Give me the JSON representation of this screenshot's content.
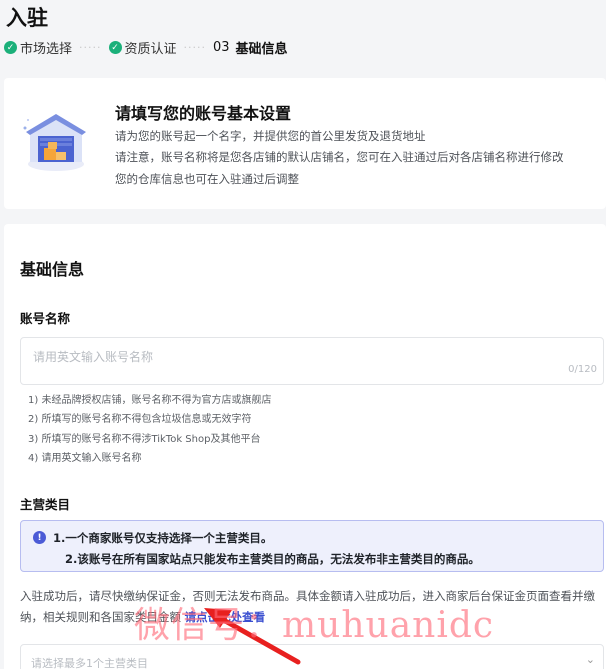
{
  "page": {
    "title": "入驻"
  },
  "steps": [
    {
      "label": "市场选择",
      "status": "done"
    },
    {
      "label": "资质认证",
      "status": "done"
    },
    {
      "num": "03",
      "label": "基础信息",
      "status": "current"
    }
  ],
  "intro": {
    "title": "请填写您的账号基本设置",
    "lines": [
      "请为您的账号起一个名字，并提供您的首公里发货及退货地址",
      "请注意，账号名称将是您各店铺的默认店铺名，您可在入驻通过后对各店铺名称进行修改",
      "您的仓库信息也可在入驻通过后调整"
    ]
  },
  "form": {
    "section_title": "基础信息",
    "account_name": {
      "label": "账号名称",
      "placeholder": "请用英文输入账号名称",
      "value": "",
      "counter": "0/120",
      "rules": [
        "1) 未经品牌授权店铺，账号名称不得为官方店或旗舰店",
        "2) 所填写的账号名称不得包含垃圾信息或无效字符",
        "3) 所填写的账号名称不得涉TikTok Shop及其他平台",
        "4) 请用英文输入账号名称"
      ]
    },
    "main_category": {
      "label": "主营类目",
      "notice": [
        "1.一个商家账号仅支持选择一个主营类目。",
        "2.该账号在所有国家站点只能发布主营类目的商品，无法发布非主营类目的商品。"
      ],
      "deposit_text": "入驻成功后，请尽快缴纳保证金，否则无法发布商品。具体金额请入驻成功后，进入商家后台保证金页面查看并缴纳，相关规则和各国家类目金额",
      "deposit_link": "请点击此处查看",
      "select_placeholder": "请选择最多1个主营类目"
    }
  },
  "watermark": {
    "text": "微信号：muhuanidc"
  },
  "colors": {
    "accent": "#3a4fd0",
    "success": "#1bb07a",
    "notice_bg": "#eef0fc",
    "watermark": "#ff6978"
  },
  "icons": {
    "step_done": "check-circle-icon",
    "notice": "info-icon",
    "select": "chevron-down-icon",
    "intro": "warehouse-illustration"
  }
}
